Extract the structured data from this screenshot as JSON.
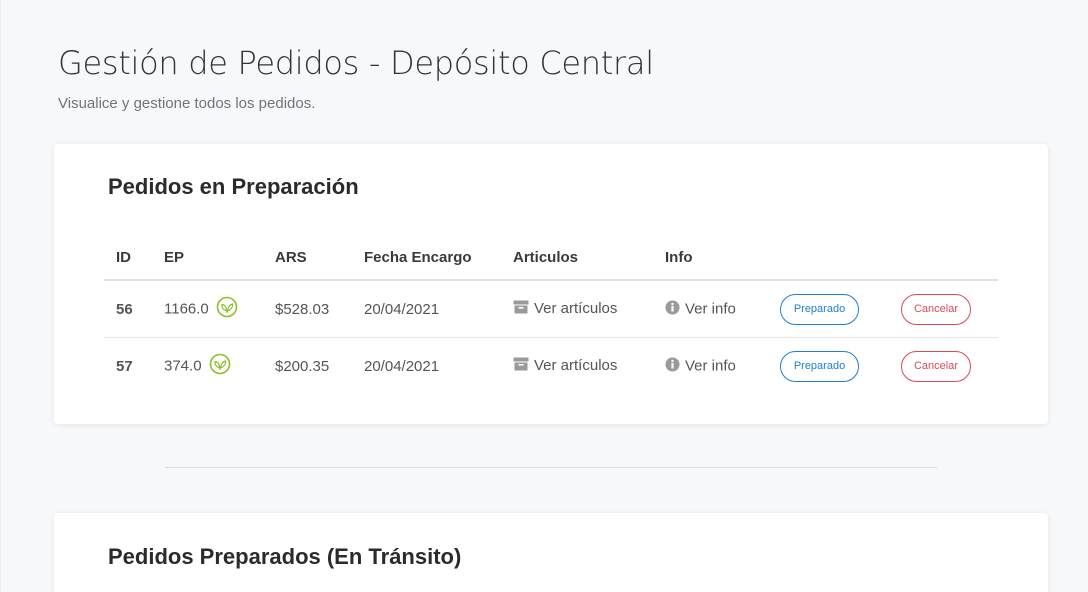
{
  "header": {
    "title": "Gestión de Pedidos - Depósito Central",
    "subtitle": "Visualice y gestione todos los pedidos."
  },
  "preparation": {
    "title": "Pedidos en Preparación",
    "columns": [
      "ID",
      "EP",
      "ARS",
      "Fecha Encargo",
      "Articulos",
      "Info",
      "",
      ""
    ],
    "rows": [
      {
        "id": "56",
        "ep": "1166.0",
        "ars": "$528.03",
        "date": "20/04/2021",
        "articles_link": "Ver artículos",
        "info_link": "Ver info",
        "prepared_label": "Preparado",
        "cancel_label": "Cancelar"
      },
      {
        "id": "57",
        "ep": "374.0",
        "ars": "$200.35",
        "date": "20/04/2021",
        "articles_link": "Ver artículos",
        "info_link": "Ver info",
        "prepared_label": "Preparado",
        "cancel_label": "Cancelar"
      }
    ]
  },
  "transit": {
    "title": "Pedidos Preparados (En Tránsito)"
  },
  "icons": {
    "ep": "eco-leaf-icon",
    "articles": "box-icon",
    "info": "info-circle-icon"
  },
  "colors": {
    "primary": "#1e7fd0",
    "danger": "#d94b57",
    "eco": "#8cbf26",
    "background": "#f7f8fa"
  }
}
